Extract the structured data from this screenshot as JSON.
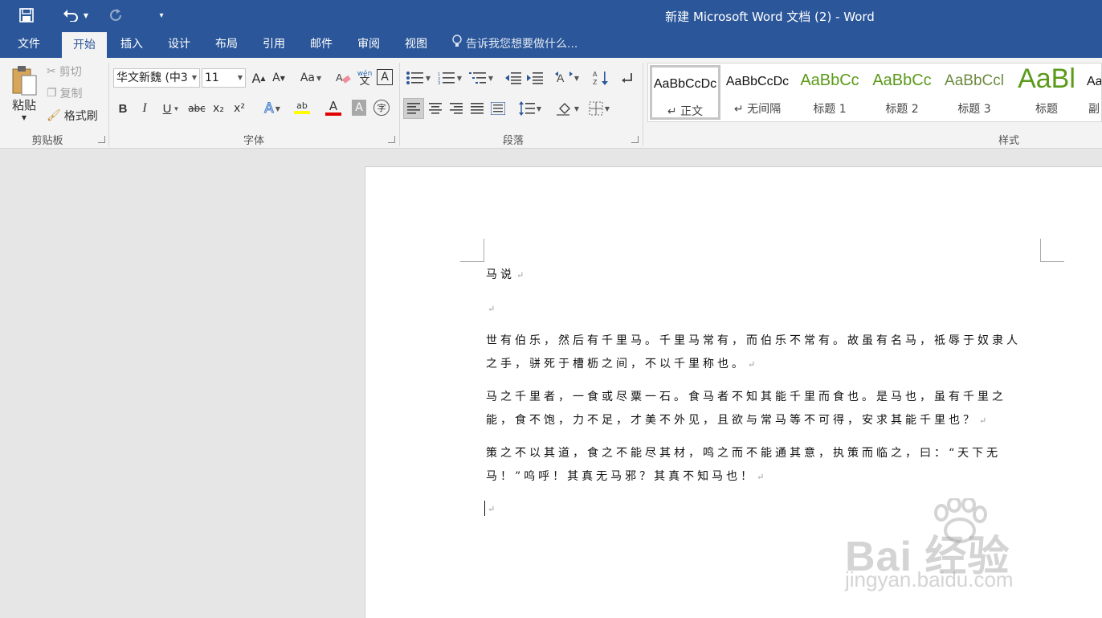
{
  "window": {
    "title": "新建 Microsoft Word 文档 (2) - Word"
  },
  "quick_access": {
    "save_icon": "save-icon",
    "undo_icon": "undo-icon",
    "redo_icon": "redo-icon",
    "customize_icon": "customize-icon"
  },
  "tabs": [
    {
      "label": "文件"
    },
    {
      "label": "开始",
      "active": true
    },
    {
      "label": "插入"
    },
    {
      "label": "设计"
    },
    {
      "label": "布局"
    },
    {
      "label": "引用"
    },
    {
      "label": "邮件"
    },
    {
      "label": "审阅"
    },
    {
      "label": "视图"
    }
  ],
  "tell_me": {
    "text": "告诉我您想要做什么..."
  },
  "ribbon": {
    "clipboard": {
      "label": "剪贴板",
      "paste": "粘贴",
      "cut": "剪切",
      "copy": "复制",
      "format_painter": "格式刷"
    },
    "font": {
      "label": "字体",
      "font_name": "华文新魏 (中3",
      "font_size": "11",
      "grow": "A",
      "shrink": "A",
      "change_case": "Aa",
      "phonetic": "wén\n文",
      "char_border": "A",
      "bold": "B",
      "italic": "I",
      "underline": "U",
      "strike": "abc",
      "subscript": "x₂",
      "superscript": "x²",
      "text_effects": "A",
      "highlight": "ab",
      "font_color": "A",
      "char_shading": "A",
      "enclose": "字"
    },
    "paragraph": {
      "label": "段落"
    },
    "styles": {
      "label": "样式",
      "items": [
        {
          "preview": "AaBbCcDc",
          "name": "↵ 正文"
        },
        {
          "preview": "AaBbCcDc",
          "name": "↵ 无间隔"
        },
        {
          "preview": "AaBbCc",
          "name": "标题 1"
        },
        {
          "preview": "AaBbCc",
          "name": "标题 2"
        },
        {
          "preview": "AaBbCcl",
          "name": "标题 3"
        },
        {
          "preview": "AaBl",
          "name": "标题"
        },
        {
          "preview": "Aa",
          "name": "副"
        }
      ]
    }
  },
  "document": {
    "lines": [
      "马说",
      "",
      "世有伯乐，然后有千里马。千里马常有，而伯乐不常有。故虽有名马，祗辱于奴隶人",
      "之手，骈死于槽枥之间，不以千里称也。",
      "马之千里者，一食或尽粟一石。食马者不知其能千里而食也。是马也，虽有千里之",
      "能，食不饱，力不足，才美不外见，且欲与常马等不可得，安求其能千里也？",
      "策之不以其道，食之不能尽其材，鸣之而不能通其意，执策而临之，曰：“天下无",
      "马！”呜呼！其真无马邪？其真不知马也！",
      ""
    ],
    "paragraph_mark": "↵"
  },
  "watermark": {
    "brand": "Bai 经验",
    "url": "jingyan.baidu.com"
  },
  "colors": {
    "title_bar": "#2b579a",
    "ribbon": "#f3f3f3",
    "highlight": "#ffff00",
    "font_color": "#e00000",
    "heading_green": "#5b9a1a"
  }
}
